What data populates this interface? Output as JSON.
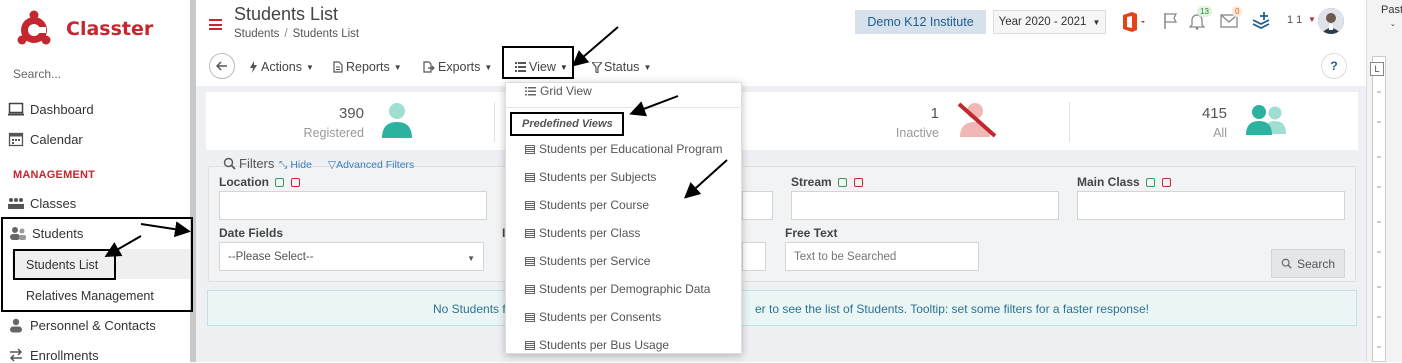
{
  "app": {
    "name": "Classter"
  },
  "sidebar": {
    "search_placeholder": "Search...",
    "items": [
      {
        "label": "Dashboard",
        "icon": "monitor-icon"
      },
      {
        "label": "Calendar",
        "icon": "calendar-icon"
      }
    ],
    "section_heading": "MANAGEMENT",
    "management": [
      {
        "label": "Classes",
        "icon": "classes-icon"
      },
      {
        "label": "Students",
        "icon": "students-icon"
      }
    ],
    "students_sub": [
      "Students List",
      "Relatives Management"
    ],
    "more": [
      {
        "label": "Personnel & Contacts",
        "icon": "person-icon"
      },
      {
        "label": "Enrollments",
        "icon": "exchange-icon"
      }
    ]
  },
  "header": {
    "title": "Students List",
    "breadcrumb": [
      "Students",
      "Students List"
    ],
    "institute": "Demo K12 Institute",
    "year": "Year 2020 - 2021",
    "notifications_count": "13",
    "messages_count": "0",
    "user_label": "1 1",
    "side_label": "Past"
  },
  "toolbar": {
    "actions": "Actions",
    "reports": "Reports",
    "exports": "Exports",
    "view": "View",
    "status": "Status",
    "help": "?"
  },
  "stats": [
    {
      "value": "390",
      "label": "Registered",
      "color": "#2bb3a0"
    },
    {
      "value": "1",
      "label": "Inactive",
      "color": "#d9534f"
    },
    {
      "value": "415",
      "label": "All",
      "color": "#2bb3a0"
    }
  ],
  "filters": {
    "title": "Filters",
    "hide": "Hide",
    "advanced": "Advanced Filters",
    "location": "Location",
    "stream": "Stream",
    "main_class": "Main Class",
    "date_fields": "Date Fields",
    "date_placeholder": "--Please Select--",
    "free_text": "Free Text",
    "free_text_placeholder": "Text to be Searched",
    "search_button": "Search"
  },
  "notice": {
    "left": "No Students f",
    "right": "er to see the list of Students. Tooltip: set some filters for a faster response!"
  },
  "view_menu": {
    "grid_view": "Grid View",
    "predefined_heading": "Predefined Views",
    "items": [
      "Students per Educational Program",
      "Students per Subjects",
      "Students per Course",
      "Students per Class",
      "Students per Service",
      "Students per Demographic Data",
      "Students per Consents",
      "Students per Bus Usage"
    ]
  },
  "colors": {
    "brand": "#c4272f",
    "accent": "#1f5e8e",
    "teal": "#2bb3a0"
  }
}
